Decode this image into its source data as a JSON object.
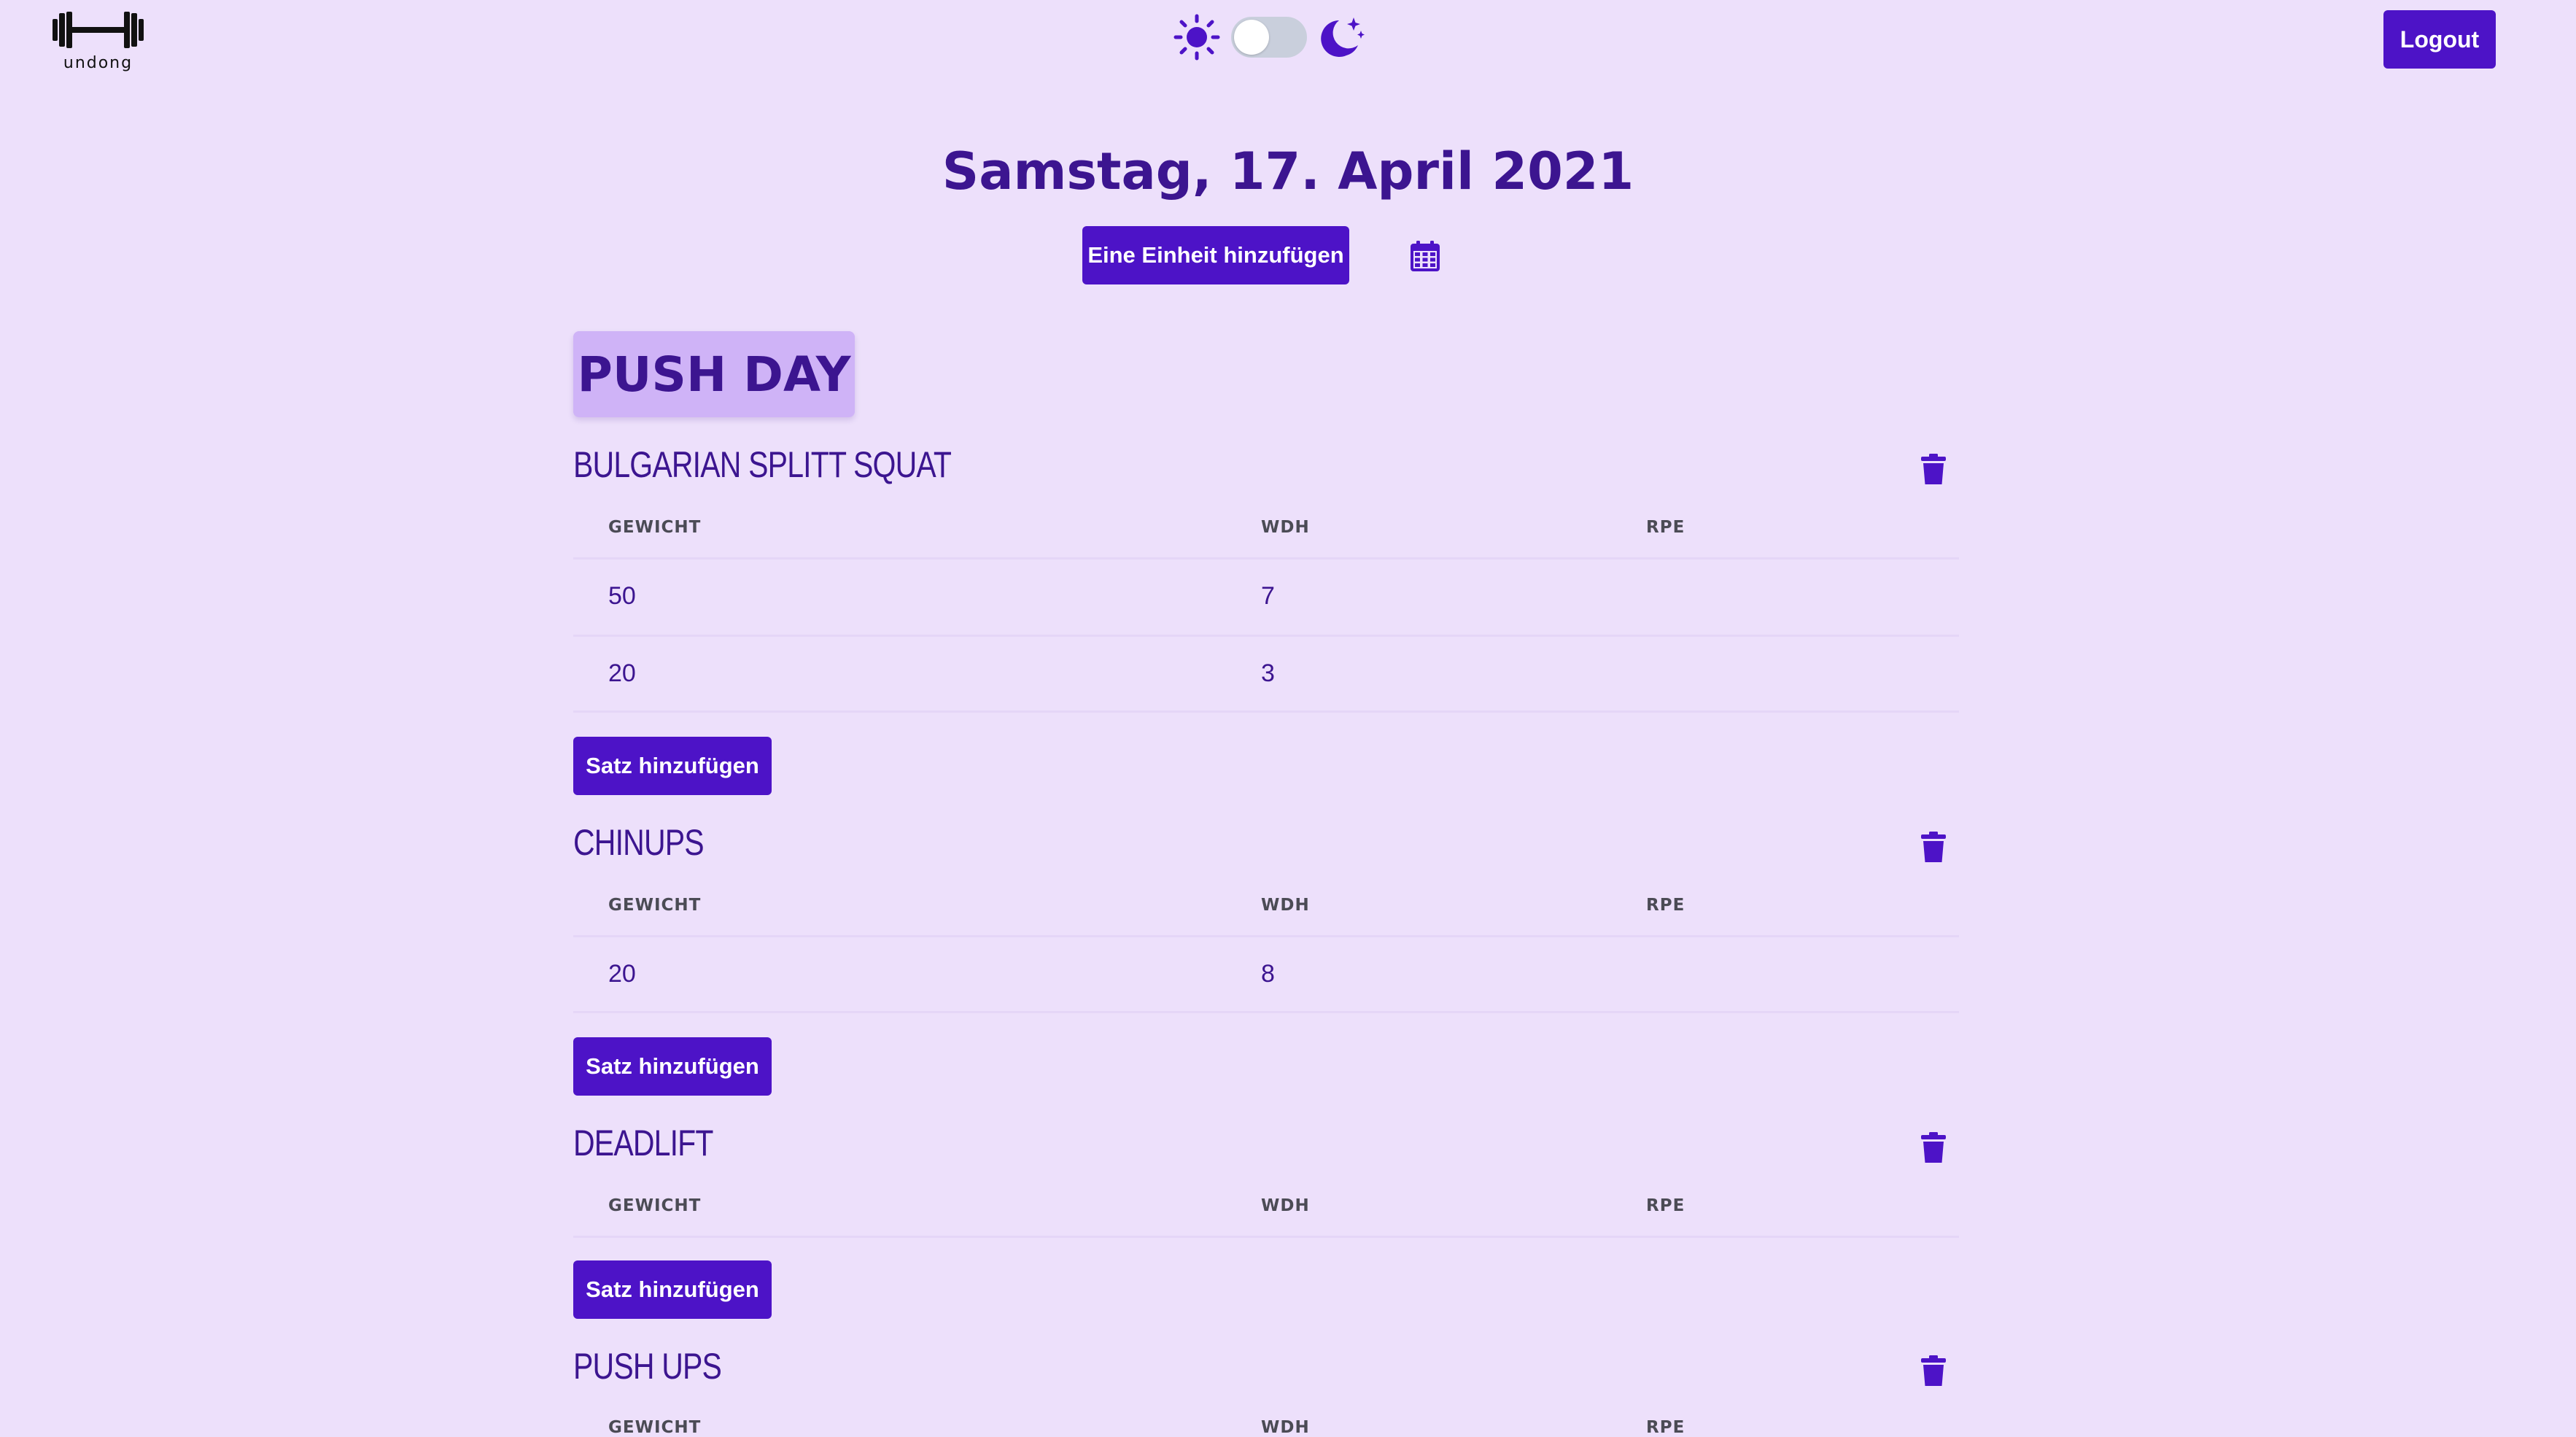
{
  "header": {
    "logo_text": "undong",
    "logout_label": "Logout"
  },
  "day": {
    "date_title": "Samstag, 17. April 2021",
    "add_unit_label": "Eine Einheit hinzufügen",
    "workout_title": "PUSH DAY"
  },
  "table_columns": [
    "GEWICHT",
    "WDH",
    "RPE"
  ],
  "add_set_label": "Satz hinzufügen",
  "exercises": [
    {
      "name": "BULGARIAN SPLITT SQUAT",
      "sets": [
        {
          "gewicht": "50",
          "wdh": "7",
          "rpe": ""
        },
        {
          "gewicht": "20",
          "wdh": "3",
          "rpe": ""
        }
      ]
    },
    {
      "name": "CHINUPS",
      "sets": [
        {
          "gewicht": "20",
          "wdh": "8",
          "rpe": ""
        }
      ]
    },
    {
      "name": "DEADLIFT",
      "sets": []
    },
    {
      "name": "PUSH UPS",
      "sets": []
    }
  ],
  "colors": {
    "background": "#ede0fb",
    "primary": "#4d13c7",
    "text": "#3c1590",
    "title_badge": "#cfb3f7",
    "toggle_track": "#c9cfdc"
  },
  "icons": {
    "logo": "barbell-icon",
    "light_mode": "sun-icon",
    "dark_mode": "moon-stars-icon",
    "calendar": "calendar-icon",
    "delete": "trash-icon"
  },
  "theme": {
    "dark_mode_enabled": false
  }
}
